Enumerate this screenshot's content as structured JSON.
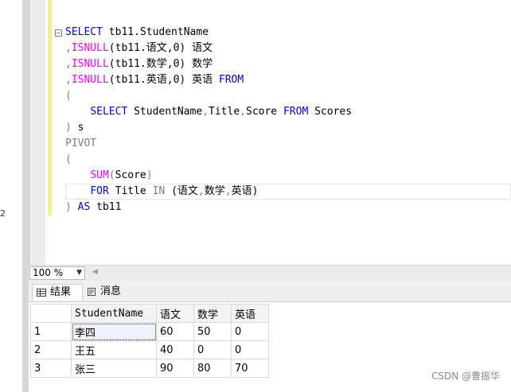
{
  "left_pane": {
    "fragment": "2"
  },
  "editor": {
    "lines": [
      [
        {
          "t": "SELECT",
          "c": "kw"
        },
        {
          "t": " tb11.StudentName",
          "c": ""
        }
      ],
      [
        {
          "t": ",",
          "c": "gray"
        },
        {
          "t": "ISNULL",
          "c": "fn"
        },
        {
          "t": "(tb11.语文,0) 语文",
          "c": ""
        }
      ],
      [
        {
          "t": ",",
          "c": "gray"
        },
        {
          "t": "ISNULL",
          "c": "fn"
        },
        {
          "t": "(tb11.数学,0) 数学",
          "c": ""
        }
      ],
      [
        {
          "t": ",",
          "c": "gray"
        },
        {
          "t": "ISNULL",
          "c": "fn"
        },
        {
          "t": "(tb11.英语,0) 英语 ",
          "c": ""
        },
        {
          "t": "FROM",
          "c": "kw"
        }
      ],
      [
        {
          "t": "(",
          "c": "gray"
        }
      ],
      [
        {
          "t": "    ",
          "c": ""
        },
        {
          "t": "SELECT",
          "c": "kw"
        },
        {
          "t": " StudentName",
          "c": ""
        },
        {
          "t": ",",
          "c": "gray"
        },
        {
          "t": "Title",
          "c": ""
        },
        {
          "t": ",",
          "c": "gray"
        },
        {
          "t": "Score ",
          "c": ""
        },
        {
          "t": "FROM",
          "c": "kw"
        },
        {
          "t": " Scores",
          "c": ""
        }
      ],
      [
        {
          "t": ")",
          "c": "gray"
        },
        {
          "t": " s",
          "c": ""
        }
      ],
      [
        {
          "t": "PIVOT",
          "c": "gray"
        }
      ],
      [
        {
          "t": "(",
          "c": "gray"
        }
      ],
      [
        {
          "t": "    ",
          "c": ""
        },
        {
          "t": "SUM",
          "c": "fn"
        },
        {
          "t": "(",
          "c": "gray"
        },
        {
          "t": "Score",
          "c": ""
        },
        {
          "t": ")",
          "c": "gray"
        }
      ],
      [
        {
          "t": "    ",
          "c": ""
        },
        {
          "t": "FOR",
          "c": "kw"
        },
        {
          "t": " Title ",
          "c": ""
        },
        {
          "t": "IN",
          "c": "gray"
        },
        {
          "t": " (语文",
          "c": ""
        },
        {
          "t": ",",
          "c": "gray"
        },
        {
          "t": "数学",
          "c": ""
        },
        {
          "t": ",",
          "c": "gray"
        },
        {
          "t": "英语)",
          "c": ""
        }
      ],
      [
        {
          "t": ")",
          "c": "gray"
        },
        {
          "t": " ",
          "c": ""
        },
        {
          "t": "AS",
          "c": "kw"
        },
        {
          "t": " tb11",
          "c": ""
        }
      ]
    ]
  },
  "zoom": {
    "value": "100 %"
  },
  "tabs": {
    "results": "结果",
    "messages": "消息"
  },
  "grid": {
    "columns": [
      "StudentName",
      "语文",
      "数学",
      "英语"
    ],
    "rows": [
      {
        "num": "1",
        "cells": [
          "李四",
          "60",
          "50",
          "0"
        ]
      },
      {
        "num": "2",
        "cells": [
          "王五",
          "40",
          "0",
          "0"
        ]
      },
      {
        "num": "3",
        "cells": [
          "张三",
          "90",
          "80",
          "70"
        ]
      }
    ]
  },
  "watermark": "CSDN @曹振华"
}
